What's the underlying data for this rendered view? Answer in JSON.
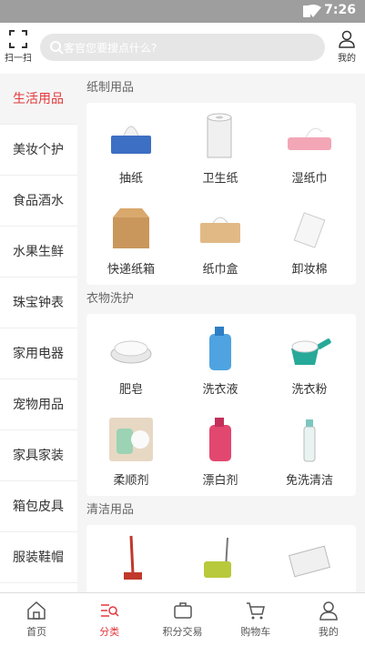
{
  "status_bar": {
    "time": "7:26"
  },
  "header": {
    "scan_label": "扫一扫",
    "search_placeholder": "客官您要搜点什么?",
    "mine_label": "我的"
  },
  "sidebar": {
    "items": [
      {
        "label": "生活用品",
        "active": true
      },
      {
        "label": "美妆个护"
      },
      {
        "label": "食品酒水"
      },
      {
        "label": "水果生鲜"
      },
      {
        "label": "珠宝钟表"
      },
      {
        "label": "家用电器"
      },
      {
        "label": "宠物用品"
      },
      {
        "label": "家具家装"
      },
      {
        "label": "箱包皮具"
      },
      {
        "label": "服装鞋帽"
      }
    ]
  },
  "sections": [
    {
      "title": "纸制用品",
      "items": [
        {
          "label": "抽纸",
          "icon": "tissue-box-icon"
        },
        {
          "label": "卫生纸",
          "icon": "toilet-roll-icon"
        },
        {
          "label": "湿纸巾",
          "icon": "wet-wipes-icon"
        },
        {
          "label": "快递纸箱",
          "icon": "cardboard-box-icon"
        },
        {
          "label": "纸巾盒",
          "icon": "tissue-holder-icon"
        },
        {
          "label": "卸妆棉",
          "icon": "cotton-pad-icon"
        }
      ]
    },
    {
      "title": "衣物洗护",
      "items": [
        {
          "label": "肥皂",
          "icon": "soap-icon"
        },
        {
          "label": "洗衣液",
          "icon": "detergent-bottle-icon"
        },
        {
          "label": "洗衣粉",
          "icon": "washing-powder-icon"
        },
        {
          "label": "柔顺剂",
          "icon": "softener-icon"
        },
        {
          "label": "漂白剂",
          "icon": "bleach-bottle-icon"
        },
        {
          "label": "免洗清洁",
          "icon": "spray-bottle-icon"
        }
      ]
    },
    {
      "title": "清洁用品",
      "items": [
        {
          "label": "",
          "icon": "mop-icon"
        },
        {
          "label": "",
          "icon": "mop-bucket-icon"
        },
        {
          "label": "",
          "icon": "cleaning-cloth-icon"
        }
      ]
    }
  ],
  "bottom_nav": {
    "items": [
      {
        "label": "首页",
        "icon": "home-icon"
      },
      {
        "label": "分类",
        "icon": "category-search-icon",
        "active": true
      },
      {
        "label": "积分交易",
        "icon": "briefcase-icon"
      },
      {
        "label": "购物车",
        "icon": "cart-icon"
      },
      {
        "label": "我的",
        "icon": "user-icon"
      }
    ]
  },
  "colors": {
    "accent": "#e4393c",
    "status_bar": "#9e9e9e"
  }
}
